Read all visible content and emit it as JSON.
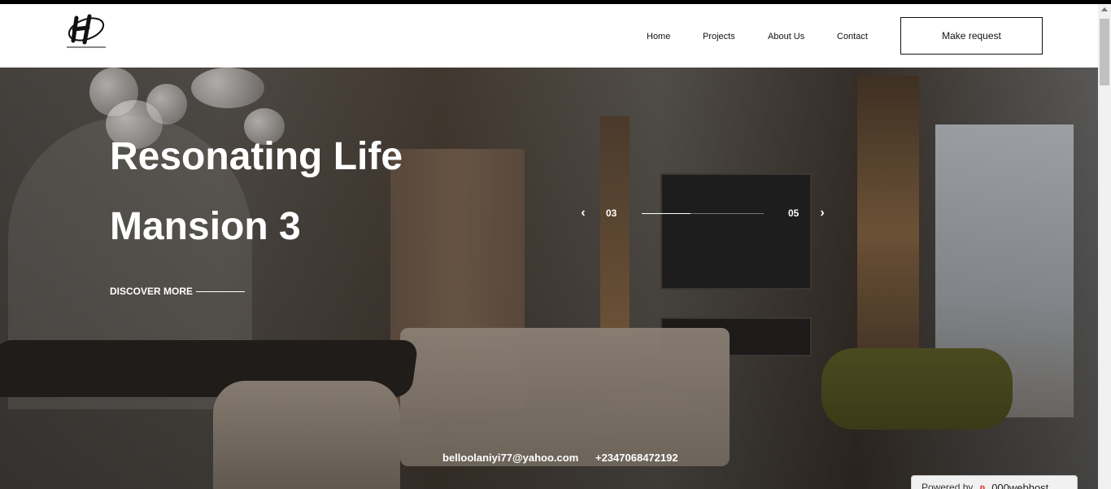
{
  "header": {
    "logo_alt": "HALLMARK STUDIO",
    "nav": [
      {
        "label": "Home",
        "name": "nav-home"
      },
      {
        "label": "Projects",
        "name": "nav-projects"
      },
      {
        "label": "About Us",
        "name": "nav-about-us"
      },
      {
        "label": "Contact",
        "name": "nav-contact"
      }
    ],
    "cta_label": "Make request"
  },
  "hero": {
    "title_line1": "Resonating Life",
    "title_line2": "Mansion 3",
    "discover_label": "DISCOVER MORE",
    "slider": {
      "current": "03",
      "total": "05",
      "progress": 0.4,
      "prev_icon": "chevron-left-icon",
      "next_icon": "chevron-right-icon"
    },
    "email": "belloolaniyi77@yahoo.com",
    "phone": "+2347068472192"
  },
  "badge": {
    "powered_by": "Powered by",
    "brand": "000webhost"
  },
  "colors": {
    "header_bg": "#ffffff",
    "text_dark": "#111111",
    "hero_text": "#ffffff"
  }
}
